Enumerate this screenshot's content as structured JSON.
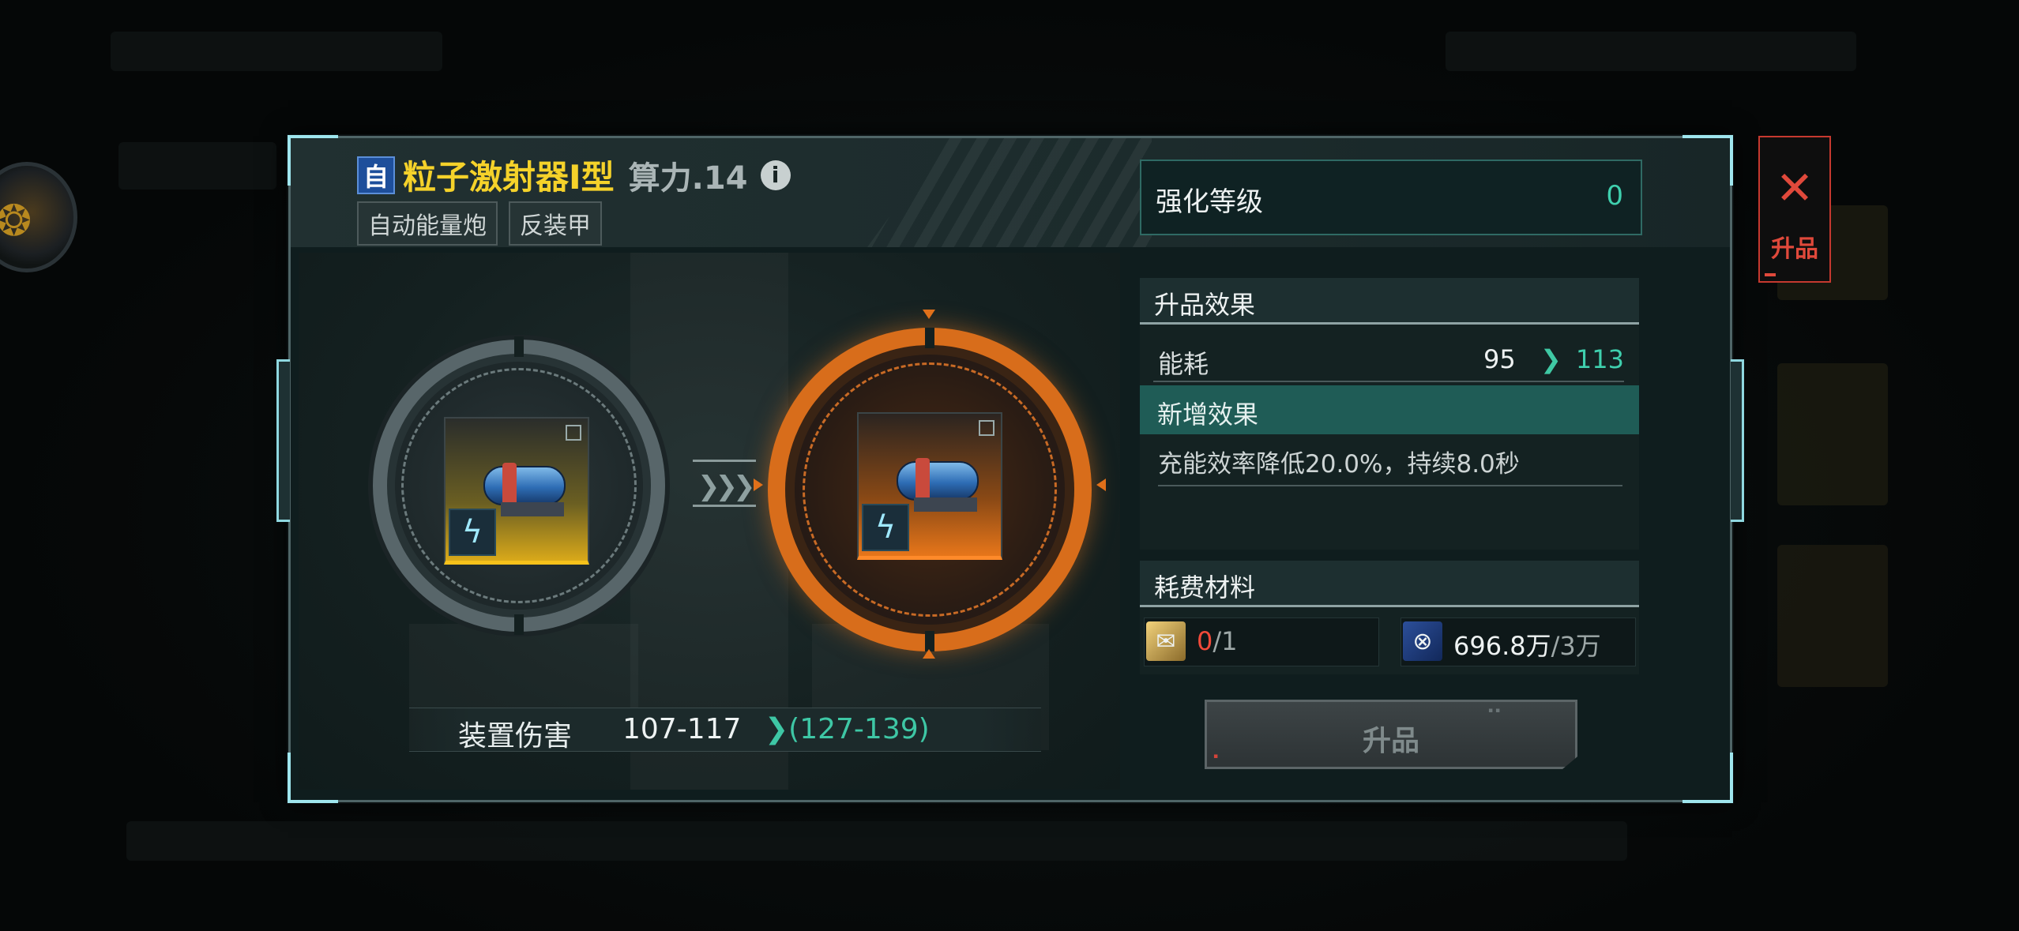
{
  "item": {
    "type_badge": "自",
    "name": "粒子激射器I型",
    "power": "算力.14",
    "tags": [
      "自动能量炮",
      "反装甲"
    ]
  },
  "enhance": {
    "label": "强化等级",
    "value": "0"
  },
  "upgrade_effect": {
    "header": "升品效果",
    "energy_label": "能耗",
    "energy_from": "95",
    "energy_to": "113",
    "new_effect_header": "新增效果",
    "new_effect_text": "充能效率降低20.0%，持续8.0秒"
  },
  "materials": {
    "header": "耗费材料",
    "slot1": {
      "have": "0",
      "need": "/1"
    },
    "slot2": {
      "have": "696.8万",
      "need": "/3万"
    }
  },
  "damage": {
    "label": "装置伤害",
    "current": "107-117",
    "next": "(127-139)"
  },
  "buttons": {
    "upgrade": "升品",
    "side_tab": "升品"
  },
  "icons": [
    "info-icon",
    "close-x-icon",
    "upgrade-scroll-icon",
    "coin-icon",
    "lightning-icon",
    "cannon-icon",
    "chevron-right-icon"
  ],
  "colors": {
    "accent_teal": "#3fd0ae",
    "title_yellow": "#f5d22a",
    "rarity_orange": "#e7761a",
    "alert_red": "#e0493b"
  }
}
